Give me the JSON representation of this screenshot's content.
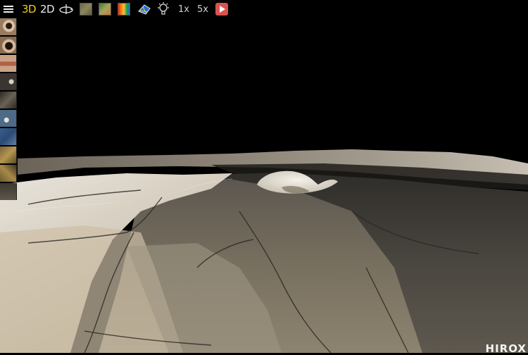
{
  "toolbar": {
    "menu": {
      "icon": "menu-icon"
    },
    "mode_3d": {
      "label": "3D",
      "active": true
    },
    "mode_2d": {
      "label": "2D"
    },
    "rotate": {
      "icon": "rotate-axis-icon"
    },
    "texture_natural": {
      "icon": "texture-natural-icon"
    },
    "texture_green": {
      "icon": "texture-green-icon"
    },
    "texture_heatmap": {
      "icon": "heatmap-icon"
    },
    "texture_mesh": {
      "icon": "mesh-icon"
    },
    "light": {
      "icon": "lightbulb-icon"
    },
    "zoom_1x": {
      "label": "1x"
    },
    "zoom_5x": {
      "label": "5x"
    },
    "play": {
      "icon": "play-icon"
    }
  },
  "thumbnails": [
    {
      "name": "eye-closeup-1"
    },
    {
      "name": "eye-closeup-2"
    },
    {
      "name": "lips-closeup"
    },
    {
      "name": "dark-detail-1"
    },
    {
      "name": "dark-detail-2"
    },
    {
      "name": "blue-detail-1"
    },
    {
      "name": "blue-detail-2"
    },
    {
      "name": "gold-detail-1"
    },
    {
      "name": "gold-detail-2"
    },
    {
      "name": "dark-detail-3"
    }
  ],
  "brand": {
    "label": "HIROX"
  },
  "colors": {
    "active_mode": "#f2d21b",
    "play_button": "#d9534f",
    "background": "#000000"
  }
}
